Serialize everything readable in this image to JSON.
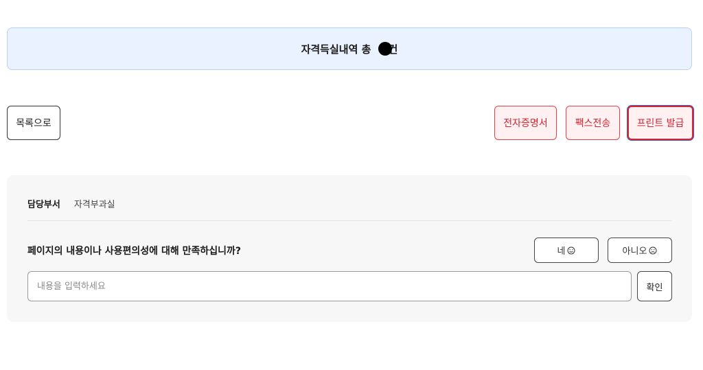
{
  "result": {
    "prefix": "자격득실내역 총",
    "count_redacted": true,
    "suffix": "건"
  },
  "actions": {
    "list_label": "목록으로",
    "cert_label": "전자증명서",
    "fax_label": "팩스전송",
    "print_label": "프린트 발급"
  },
  "feedback": {
    "dept_label": "담당부서",
    "dept_value": "자격부과실",
    "question": "페이지의 내용이나 사용편의성에 대해 만족하십니까?",
    "yes_label": "네",
    "yes_icon": "smile-icon",
    "no_label": "아니오",
    "no_icon": "frown-icon",
    "input_placeholder": "내용을 입력하세요",
    "input_value": "",
    "confirm_label": "확인"
  },
  "colors": {
    "banner_bg": "#eaf2ff",
    "banner_border": "#b9d1f2",
    "accent_red": "#d6262f",
    "red_button_bg": "#fff0f1",
    "panel_bg": "#f7f7f7",
    "focus_ring": "#3b5bd6"
  }
}
